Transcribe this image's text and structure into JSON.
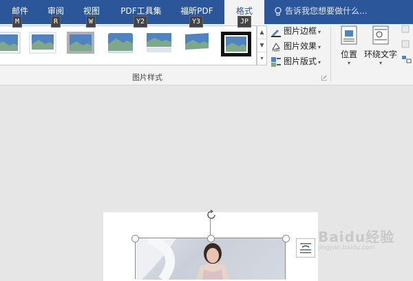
{
  "tabs": [
    {
      "label": "邮件",
      "keytip": "M"
    },
    {
      "label": "审阅",
      "keytip": "R"
    },
    {
      "label": "视图",
      "keytip": "W"
    },
    {
      "label": "PDF工具集",
      "keytip": "Y2"
    },
    {
      "label": "福昕PDF",
      "keytip": "Y3"
    },
    {
      "label": "格式",
      "keytip": "JP",
      "active": true
    }
  ],
  "tell_me": {
    "placeholder": "告诉我您想要做什么...",
    "icon": "lightbulb-icon"
  },
  "picture_styles": {
    "group_label": "图片样式",
    "styles_count_visible": 7,
    "selected_index": 6,
    "commands": [
      {
        "label": "图片边框",
        "icon": "picture-border-icon"
      },
      {
        "label": "图片效果",
        "icon": "picture-effects-icon"
      },
      {
        "label": "图片版式",
        "icon": "picture-layout-icon"
      }
    ]
  },
  "arrange": {
    "position_label": "位置",
    "wrap_text_label": "环绕文字"
  },
  "watermark": {
    "brand": "Baidu经验",
    "url": "jingyan.baidu.com"
  },
  "colors": {
    "accent": "#2b579a",
    "ribbon": "#f3f3f3",
    "canvas": "#e6e6e6"
  }
}
